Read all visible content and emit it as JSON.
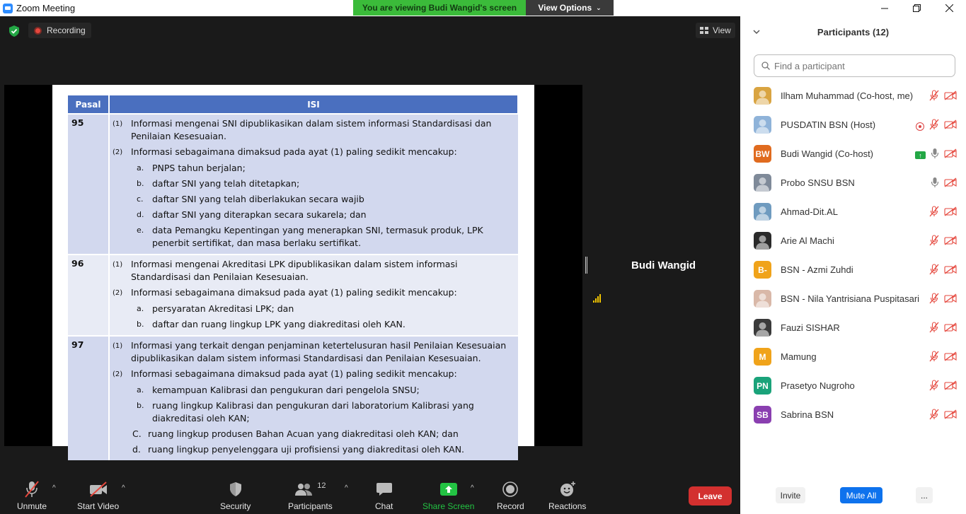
{
  "window": {
    "title": "Zoom Meeting"
  },
  "banner": {
    "viewing_text": "You are viewing Budi Wangid's screen",
    "view_options": "View Options"
  },
  "meeting": {
    "recording_label": "Recording",
    "view_label": "View",
    "active_speaker": "Budi Wangid"
  },
  "slide": {
    "header": {
      "col1": "Pasal",
      "col2": "ISI"
    },
    "rows": [
      {
        "pasal": "95",
        "items": [
          {
            "kind": "para",
            "num": "(1)",
            "text": "Informasi mengenai  SNI dipublikasikan dalam sistem informasi Standardisasi dan Penilaian Kesesuaian."
          },
          {
            "kind": "para",
            "num": "(2)",
            "text": "Informasi  sebagaimana  dimaksud pada  ayat  (1) paling sedikit mencakup:"
          },
          {
            "kind": "sub",
            "num": "a.",
            "text": "PNPS tahun  berjalan;"
          },
          {
            "kind": "sub",
            "num": "b.",
            "text": "daftar SNI yang telah ditetapkan;"
          },
          {
            "kind": "sub",
            "num": "c.",
            "text": "daftar SNI yang telah  diberlakukan  secara wajib"
          },
          {
            "kind": "sub",
            "num": "d.",
            "text": "daftar SNI yang diterapkan secara sukarela; dan"
          },
          {
            "kind": "sub",
            "num": "e.",
            "text": "data Pemangku Kepentingan yang menerapkan SNI, termasuk produk, LPK penerbit sertifikat, dan masa berlaku sertifikat."
          }
        ]
      },
      {
        "pasal": "96",
        "items": [
          {
            "kind": "para",
            "num": "(1)",
            "text": "Informasi mengenai Akreditasi LPK dipublikasikan dalam sistem informasi Standardisasi dan Penilaian Kesesuaian."
          },
          {
            "kind": "para",
            "num": "(2)",
            "text": "Informasi  sebagaimana  dimaksud pada  ayat  (1) paling sedikit mencakup:"
          },
          {
            "kind": "sub",
            "num": "a.",
            "text": "persyaratan Akreditasi LPK; dan"
          },
          {
            "kind": "sub",
            "num": "b.",
            "text": "daftar dan ruang lingkup LPK yang  diakreditasi  oleh KAN."
          }
        ]
      },
      {
        "pasal": "97",
        "items": [
          {
            "kind": "para",
            "num": "(1)",
            "text": "Informasi yang terkait dengan penjaminan ketertelusuran hasil Penilaian Kesesuaian dipublikasikan dalam sistem informasi Standardisasi dan Penilaian  Kesesuaian."
          },
          {
            "kind": "para",
            "num": "(2)",
            "text": "Informasi sebagaimana dimaksud pada ayat (1) paling sedikit mencakup:"
          },
          {
            "kind": "sub",
            "num": "a.",
            "text": "kemampuan Kalibrasi dan pengukuran dari pengelola SNSU;"
          },
          {
            "kind": "sub",
            "num": "b.",
            "text": "ruang lingkup Kalibrasi dan pengukuran dari laboratorium Kalibrasi yang diakreditasi oleh  KAN;"
          },
          {
            "kind": "sub2",
            "num": "C.",
            "text": "ruang lingkup produsen Bahan Acuan yang diakreditasi oleh KAN; dan"
          },
          {
            "kind": "sub2",
            "num": "d.",
            "text": "ruang lingkup penyelenggara                     uji profisiensi yang diakreditasi oleh KAN."
          }
        ]
      }
    ]
  },
  "toolbar": {
    "unmute": "Unmute",
    "start_video": "Start Video",
    "security": "Security",
    "participants": "Participants",
    "participants_count": "12",
    "chat": "Chat",
    "share_screen": "Share Screen",
    "record": "Record",
    "reactions": "Reactions",
    "leave": "Leave"
  },
  "colors": {
    "share_green": "#23c343",
    "leave_red": "#d3302f",
    "mute_red": "#e5473d",
    "brand_blue": "#2d8cff"
  },
  "participants_panel": {
    "title": "Participants (12)",
    "search_placeholder": "Find a participant",
    "invite": "Invite",
    "mute_all": "Mute All",
    "more": "...",
    "list": [
      {
        "name": "Ilham Muhammad (Co-host, me)",
        "initials": "",
        "avatar_color": "#d9a441",
        "mic": "muted",
        "badge": ""
      },
      {
        "name": "PUSDATIN BSN (Host)",
        "initials": "",
        "avatar_color": "#8fb3d9",
        "mic": "muted",
        "badge": "recording"
      },
      {
        "name": "Budi Wangid (Co-host)",
        "initials": "BW",
        "avatar_color": "#e06b1f",
        "mic": "on",
        "badge": "sharing"
      },
      {
        "name": "Probo SNSU BSN",
        "initials": "",
        "avatar_color": "#7f8a99",
        "mic": "on",
        "badge": ""
      },
      {
        "name": "Ahmad-Dit.AL",
        "initials": "",
        "avatar_color": "#6f9bbf",
        "mic": "muted",
        "badge": ""
      },
      {
        "name": "Arie Al Machi",
        "initials": "",
        "avatar_color": "#2a2a2a",
        "mic": "muted",
        "badge": ""
      },
      {
        "name": "BSN - Azmi Zuhdi",
        "initials": "B-",
        "avatar_color": "#f0a31a",
        "mic": "muted",
        "badge": ""
      },
      {
        "name": "BSN - Nila Yantrisiana Puspitasari",
        "initials": "",
        "avatar_color": "#d9b8a8",
        "mic": "muted",
        "badge": ""
      },
      {
        "name": "Fauzi SISHAR",
        "initials": "",
        "avatar_color": "#3a3a3a",
        "mic": "muted",
        "badge": ""
      },
      {
        "name": "Mamung",
        "initials": "M",
        "avatar_color": "#f0a31a",
        "mic": "muted",
        "badge": ""
      },
      {
        "name": "Prasetyo Nugroho",
        "initials": "PN",
        "avatar_color": "#1aa37a",
        "mic": "muted",
        "badge": ""
      },
      {
        "name": "Sabrina BSN",
        "initials": "SB",
        "avatar_color": "#8a3fb0",
        "mic": "muted",
        "badge": ""
      }
    ]
  }
}
